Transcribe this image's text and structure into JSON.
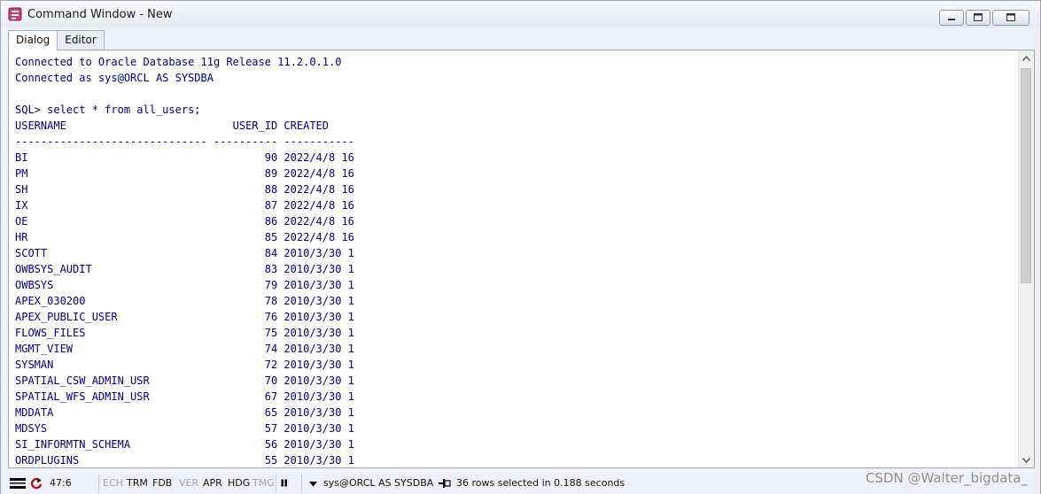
{
  "window": {
    "title": "Command Window - New"
  },
  "tabs": [
    {
      "label": "Dialog",
      "active": true
    },
    {
      "label": "Editor",
      "active": false
    }
  ],
  "output": {
    "lines": [
      "Connected to Oracle Database 11g Release 11.2.0.1.0",
      "Connected as sys@ORCL AS SYSDBA",
      "",
      "SQL> select * from all_users;",
      "USERNAME                          USER_ID CREATED",
      "------------------------------ ---------- -----------",
      "BI                                     90 2022/4/8 16",
      "PM                                     89 2022/4/8 16",
      "SH                                     88 2022/4/8 16",
      "IX                                     87 2022/4/8 16",
      "OE                                     86 2022/4/8 16",
      "HR                                     85 2022/4/8 16",
      "SCOTT                                  84 2010/3/30 1",
      "OWBSYS_AUDIT                           83 2010/3/30 1",
      "OWBSYS                                 79 2010/3/30 1",
      "APEX_030200                            78 2010/3/30 1",
      "APEX_PUBLIC_USER                       76 2010/3/30 1",
      "FLOWS_FILES                            75 2010/3/30 1",
      "MGMT_VIEW                              74 2010/3/30 1",
      "SYSMAN                                 72 2010/3/30 1",
      "SPATIAL_CSW_ADMIN_USR                  70 2010/3/30 1",
      "SPATIAL_WFS_ADMIN_USR                  67 2010/3/30 1",
      "MDDATA                                 65 2010/3/30 1",
      "MDSYS                                  57 2010/3/30 1",
      "SI_INFORMTN_SCHEMA                     56 2010/3/30 1",
      "ORDPLUGINS                             55 2010/3/30 1"
    ]
  },
  "statusbar": {
    "position": "47:6",
    "ech": "ECH",
    "trm": "TRM",
    "fdb": "FDB",
    "ver": "VER",
    "apr": "APR",
    "hdg": "HDG",
    "tmg": "TMG",
    "connection": "sys@ORCL AS SYSDBA",
    "message": "36 rows selected in 0.188 seconds"
  },
  "watermark": "CSDN @Walter_bigdata_",
  "colors": {
    "output_text": "#00007f",
    "window_bg": "#eef2f8"
  }
}
